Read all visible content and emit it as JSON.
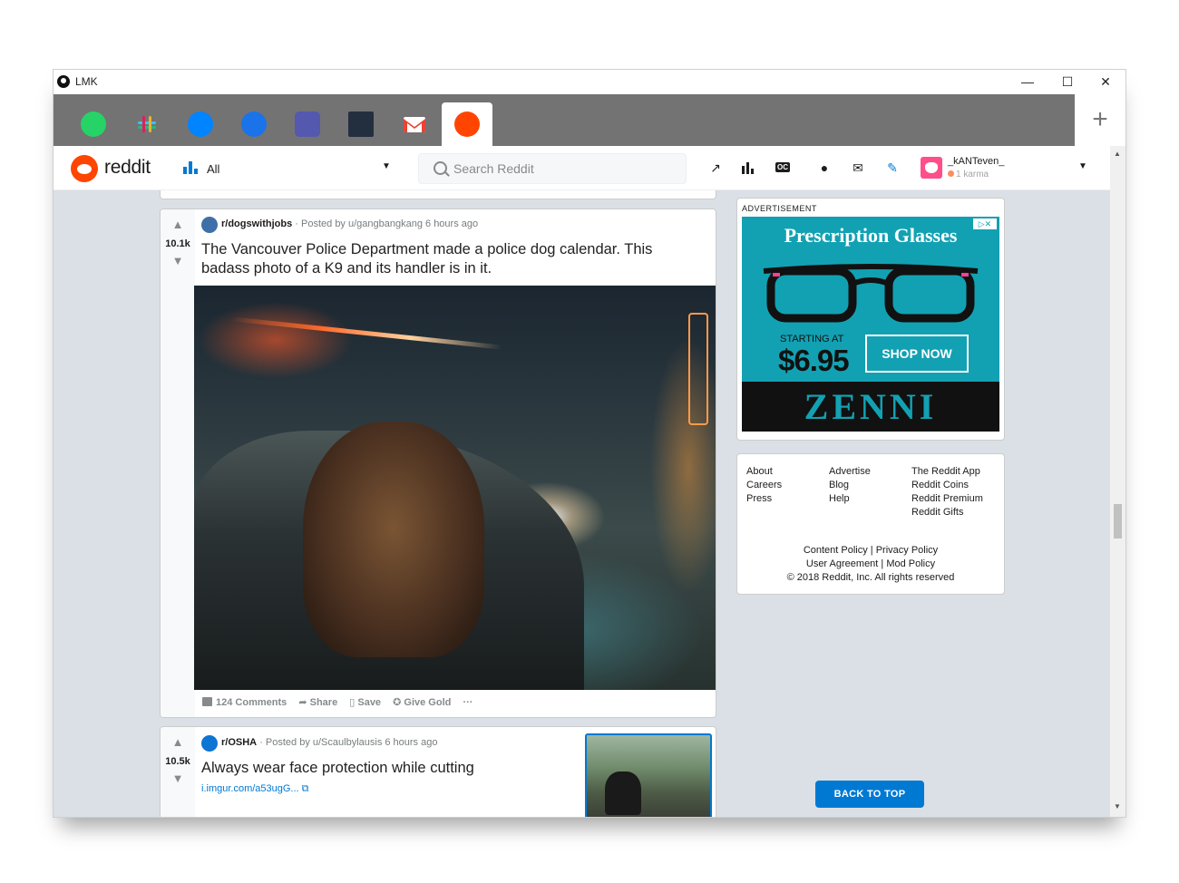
{
  "window": {
    "title": "LMK",
    "controls": {
      "minimize": "—",
      "maximize": "☐",
      "close": "✕"
    }
  },
  "tabs": [
    {
      "name": "WhatsApp",
      "icon": "whatsapp-icon",
      "color": "#25d366"
    },
    {
      "name": "Slack",
      "icon": "slack-icon",
      "color": "#e01e5a"
    },
    {
      "name": "Messenger",
      "icon": "messenger-icon",
      "color": "#0084ff"
    },
    {
      "name": "Messages",
      "icon": "messages-icon",
      "color": "#1a73e8"
    },
    {
      "name": "Teams",
      "icon": "teams-icon",
      "color": "#5558af"
    },
    {
      "name": "Amazon",
      "icon": "amazon-icon",
      "color": "#232f3e"
    },
    {
      "name": "Gmail",
      "icon": "gmail-icon",
      "color": "#ea4335"
    },
    {
      "name": "Reddit",
      "icon": "reddit-icon",
      "color": "#ff4500",
      "active": true
    }
  ],
  "add_tab": "+",
  "header": {
    "logo_text": "reddit",
    "feed_label": "All",
    "search_placeholder": "Search Reddit",
    "icons": [
      "trending-icon",
      "stats-icon",
      "oc-icon",
      "chat-icon",
      "mail-icon",
      "pencil-icon"
    ],
    "oc_label": "OC",
    "username": "_kANTeven_",
    "karma": "1 karma"
  },
  "posts": [
    {
      "votes": "10.1k",
      "subreddit": "r/dogswithjobs",
      "posted_by": "· Posted by u/gangbangkang 6 hours ago",
      "title": "The Vancouver Police Department made a police dog calendar. This badass photo of a K9 and its handler is in it.",
      "actions": {
        "comments": "124 Comments",
        "share": "Share",
        "save": "Save",
        "give_gold": "Give Gold",
        "more": "···"
      }
    },
    {
      "votes": "10.5k",
      "subreddit": "r/OSHA",
      "posted_by": "· Posted by u/Scaulbylausis 6 hours ago",
      "title": "Always wear face protection while cutting",
      "link": "i.imgur.com/a53ugG... ⧉"
    }
  ],
  "ad": {
    "label": "ADVERTISEMENT",
    "headline": "Prescription Glasses",
    "starting_at": "STARTING AT",
    "price": "$6.95",
    "cta": "SHOP NOW",
    "brand": "ZENNI",
    "choices": "▷✕"
  },
  "footer": {
    "col1": [
      "About",
      "Careers",
      "Press"
    ],
    "col2": [
      "Advertise",
      "Blog",
      "Help"
    ],
    "col3": [
      "The Reddit App",
      "Reddit Coins",
      "Reddit Premium",
      "Reddit Gifts"
    ],
    "policy_line1": "Content Policy |  Privacy Policy",
    "policy_line2": "User Agreement |  Mod Policy",
    "copyright": "© 2018 Reddit, Inc. All rights reserved"
  },
  "back_to_top": "BACK TO TOP"
}
